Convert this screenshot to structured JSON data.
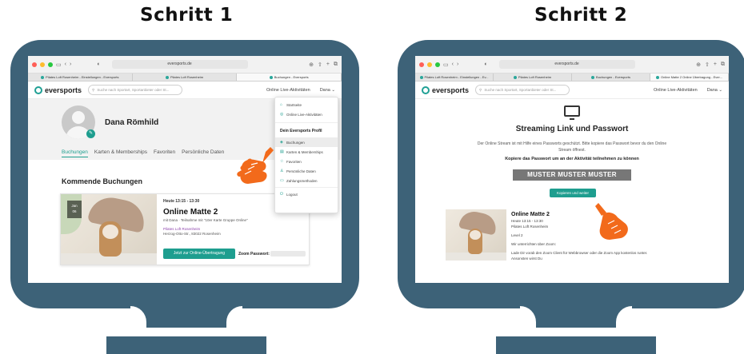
{
  "step1": {
    "title": "Schritt 1",
    "browser": {
      "address": "eversports.de",
      "tabs": [
        {
          "label": "Pilates Loft Rosenheim - Einstellungen - Eversports"
        },
        {
          "label": "Pilates Loft Rosenheim"
        },
        {
          "label": "Buchungen - Eversports"
        }
      ]
    },
    "header": {
      "logo": "eversports",
      "search_placeholder": "Suche nach Sportart, Sportanbieter oder St...",
      "live": "Online Live-Aktivitäten",
      "user": "Dana"
    },
    "profile": {
      "name": "Dana Römhild",
      "tabs": [
        "Buchungen",
        "Karten & Memberships",
        "Favoriten",
        "Persönliche Daten"
      ]
    },
    "section_title": "Kommende Buchungen",
    "booking": {
      "date_month": "Jan",
      "date_day": "06",
      "time": "Heute 13:15 - 13:30",
      "title": "Online Matte 2",
      "subtitle": "mit Dana · Teilnahme mit \"10er Karte Gruppe Online\"",
      "studio": "Pilates Loft Rosenheim",
      "address": "Herzog-Otto-Str., 83022 Rosenheim",
      "button": "Jetzt zur Online-Übertragung",
      "zoom_label": "Zoom Passwort:"
    },
    "dropdown": {
      "top_items": [
        "Startseite",
        "Online Live-Aktivitäten"
      ],
      "heading": "Dein Eversports Profil",
      "items": [
        "Buchungen",
        "Karten & Memberships",
        "Favoriten",
        "Persönliche Daten",
        "Zahlungsmethoden"
      ],
      "logout": "Logout"
    }
  },
  "step2": {
    "title": "Schritt 2",
    "browser": {
      "address": "eversports.de",
      "tabs": [
        {
          "label": "Pilates Loft Rosenheim - Einstellungen - Ev..."
        },
        {
          "label": "Pilates Loft Rosenheim"
        },
        {
          "label": "Buchungen - Eversports"
        },
        {
          "label": "Online Matte 2 Online Übertragung - Ever..."
        }
      ]
    },
    "header": {
      "logo": "eversports",
      "search_placeholder": "Suche nach Sportart, Sportanbieter oder St...",
      "live": "Online Live-Aktivitäten",
      "user": "Dana"
    },
    "stream_title": "Streaming Link und Passwort",
    "description": "Der Online Stream ist mit Hilfe eines Passworts geschützt. Bitte kopiere das Passwort bevor du den Online Stream öffnest.",
    "bold_text": "Kopiere das Passwort um an der Aktivität teilnehmen zu können",
    "password": "MUSTER MUSTER MUSTER",
    "copy_button": "Kopieren und weiter",
    "class": {
      "title": "Online Matte 2",
      "time": "Heute 13:15 - 13:30",
      "studio": "Pilates Loft Rosenheim",
      "level": "Level 2",
      "zoom_intro": "Wir unterrichten über Zoom:",
      "zoom_text": "Lade Dir vorab den Zoom Client für Webbrowser oder die Zoom App kostenlos runter. Ansonsten wirst Du"
    }
  },
  "colors": {
    "monitor": "#3d6278",
    "accent": "#1e9e8f",
    "studio_link": "#8e44ad",
    "hand": "#f26a1b"
  }
}
